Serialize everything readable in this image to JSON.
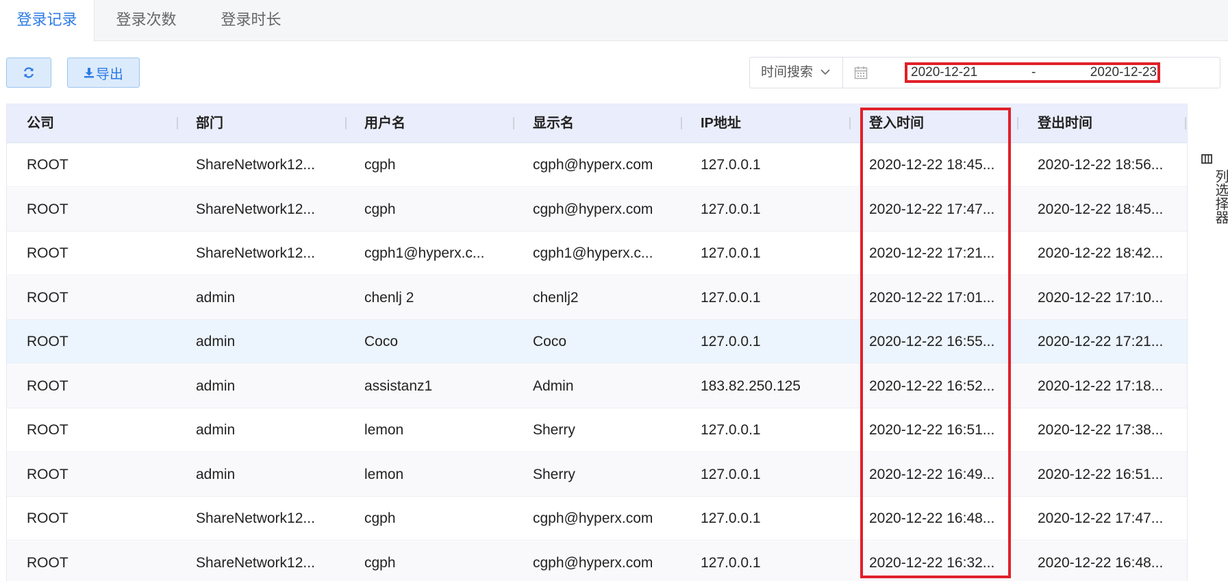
{
  "tabs": [
    {
      "label": "登录记录",
      "active": true
    },
    {
      "label": "登录次数",
      "active": false
    },
    {
      "label": "登录时长",
      "active": false
    }
  ],
  "toolbar": {
    "refresh_icon": "refresh-icon",
    "export_label": "导出",
    "export_icon": "download-icon"
  },
  "search": {
    "select_label": "时间搜索",
    "calendar_icon": "calendar-icon",
    "start_date": "2020-12-21",
    "separator": "-",
    "end_date": "2020-12-23"
  },
  "table": {
    "columns": [
      "公司",
      "部门",
      "用户名",
      "显示名",
      "IP地址",
      "登入时间",
      "登出时间"
    ],
    "rows": [
      [
        "ROOT",
        "ShareNetwork12...",
        "cgph",
        "cgph@hyperx.com",
        "127.0.0.1",
        "2020-12-22 18:45...",
        "2020-12-22 18:56..."
      ],
      [
        "ROOT",
        "ShareNetwork12...",
        "cgph",
        "cgph@hyperx.com",
        "127.0.0.1",
        "2020-12-22 17:47...",
        "2020-12-22 18:45..."
      ],
      [
        "ROOT",
        "ShareNetwork12...",
        "cgph1@hyperx.c...",
        "cgph1@hyperx.c...",
        "127.0.0.1",
        "2020-12-22 17:21...",
        "2020-12-22 18:42..."
      ],
      [
        "ROOT",
        "admin",
        "chenlj 2",
        "chenlj2",
        "127.0.0.1",
        "2020-12-22 17:01...",
        "2020-12-22 17:10..."
      ],
      [
        "ROOT",
        "admin",
        "Coco",
        "Coco",
        "127.0.0.1",
        "2020-12-22 16:55...",
        "2020-12-22 17:21..."
      ],
      [
        "ROOT",
        "admin",
        "assistanz1",
        "Admin",
        "183.82.250.125",
        "2020-12-22 16:52...",
        "2020-12-22 17:18..."
      ],
      [
        "ROOT",
        "admin",
        "lemon",
        "Sherry",
        "127.0.0.1",
        "2020-12-22 16:51...",
        "2020-12-22 17:38..."
      ],
      [
        "ROOT",
        "admin",
        "lemon",
        "Sherry",
        "127.0.0.1",
        "2020-12-22 16:49...",
        "2020-12-22 16:51..."
      ],
      [
        "ROOT",
        "ShareNetwork12...",
        "cgph",
        "cgph@hyperx.com",
        "127.0.0.1",
        "2020-12-22 16:48...",
        "2020-12-22 17:47..."
      ],
      [
        "ROOT",
        "ShareNetwork12...",
        "cgph",
        "cgph@hyperx.com",
        "127.0.0.1",
        "2020-12-22 16:32...",
        "2020-12-22 16:48..."
      ]
    ],
    "highlighted_row": 4
  },
  "column_selector": {
    "label": "列选择器",
    "icon": "columns-icon"
  },
  "colors": {
    "accent": "#2d7be5",
    "header_bg": "#eaedfb",
    "highlight_red": "#e0202a",
    "hover_row": "#ecf4fd"
  }
}
